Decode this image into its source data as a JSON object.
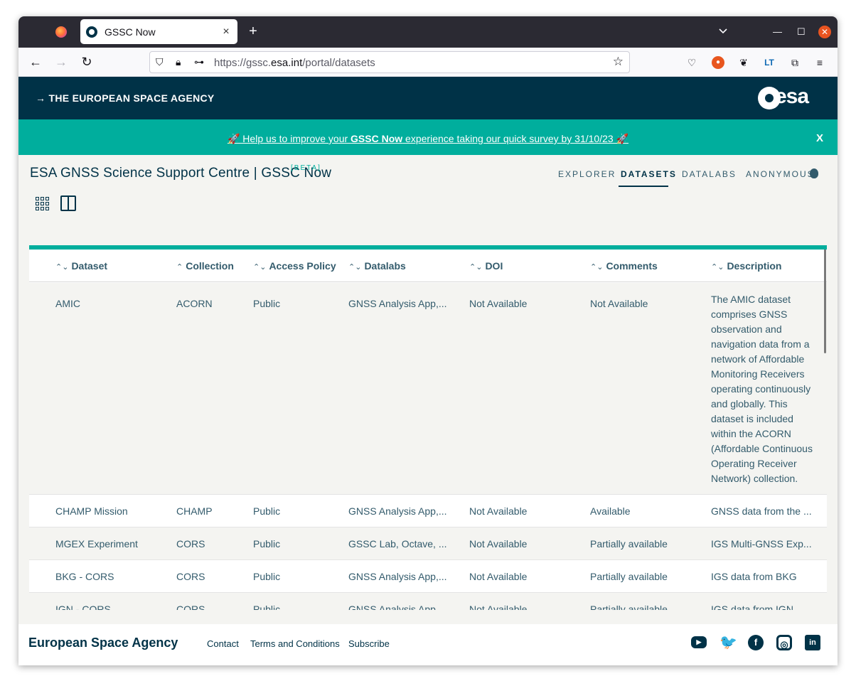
{
  "browser": {
    "tab_title": "GSSC Now",
    "tab_close": "×",
    "new_tab": "+",
    "url_prefix": "https://gssc.",
    "url_domain": "esa.int",
    "url_path": "/portal/datasets"
  },
  "header": {
    "agency": "→ THE EUROPEAN SPACE AGENCY",
    "logo_text": "esa"
  },
  "banner": {
    "text_before": "🚀 Help us to improve your ",
    "text_bold": "GSSC Now",
    "text_after": " experience taking our quick survey by 31/10/23 🚀",
    "close": "X"
  },
  "site": {
    "title": "ESA GNSS Science Support Centre | GSSC Now",
    "beta": "[BETA]"
  },
  "nav": {
    "explorer": "EXPLORER",
    "datasets": "DATASETS",
    "datalabs": "DATALABS",
    "user": "ANONYMOUS"
  },
  "table": {
    "columns": [
      "Dataset",
      "Collection",
      "Access Policy",
      "Datalabs",
      "DOI",
      "Comments",
      "Description"
    ],
    "sort_icons": [
      "⌃⌄",
      "⌃",
      "⌃⌄",
      "⌃⌄",
      "⌃⌄",
      "⌃⌄",
      "⌃⌄"
    ],
    "rows": [
      {
        "dataset": "AMIC",
        "collection": "ACORN",
        "access": "Public",
        "datalabs": "GNSS Analysis App,...",
        "doi": "Not Available",
        "comments": "Not Available",
        "description": "The AMIC dataset comprises GNSS observation and navigation data from a network of Affordable Monitoring Receivers operating continuously and globally. This dataset is included within the ACORN (Affordable Continuous Operating Receiver Network) collection."
      },
      {
        "dataset": "CHAMP Mission",
        "collection": "CHAMP",
        "access": "Public",
        "datalabs": "GNSS Analysis App,...",
        "doi": "Not Available",
        "comments": "Available",
        "description": "GNSS data from the ..."
      },
      {
        "dataset": "MGEX Experiment",
        "collection": "CORS",
        "access": "Public",
        "datalabs": "GSSC Lab, Octave, ...",
        "doi": "Not Available",
        "comments": "Partially available",
        "description": "IGS Multi-GNSS Exp..."
      },
      {
        "dataset": "BKG - CORS",
        "collection": "CORS",
        "access": "Public",
        "datalabs": "GNSS Analysis App,...",
        "doi": "Not Available",
        "comments": "Partially available",
        "description": "IGS data from BKG"
      },
      {
        "dataset": "IGN - CORS",
        "collection": "CORS",
        "access": "Public",
        "datalabs": "GNSS Analysis App,...",
        "doi": "Not Available",
        "comments": "Partially available",
        "description": "IGS data from IGN"
      }
    ]
  },
  "footer": {
    "brand": "European Space Agency",
    "links": [
      "Contact",
      "Terms and Conditions",
      "Subscribe"
    ],
    "social": [
      "youtube-icon",
      "twitter-icon",
      "facebook-icon",
      "instagram-icon",
      "linkedin-icon"
    ],
    "yt_glyph": "▶",
    "tw_glyph": "🐦",
    "fb_glyph": "f",
    "ig_glyph": "◎",
    "li_glyph": "in"
  },
  "colors": {
    "esa_navy": "#003247",
    "esa_teal": "#00ae9d",
    "browser_dark": "#2b2a33",
    "page_bg": "#f4f4f1"
  }
}
